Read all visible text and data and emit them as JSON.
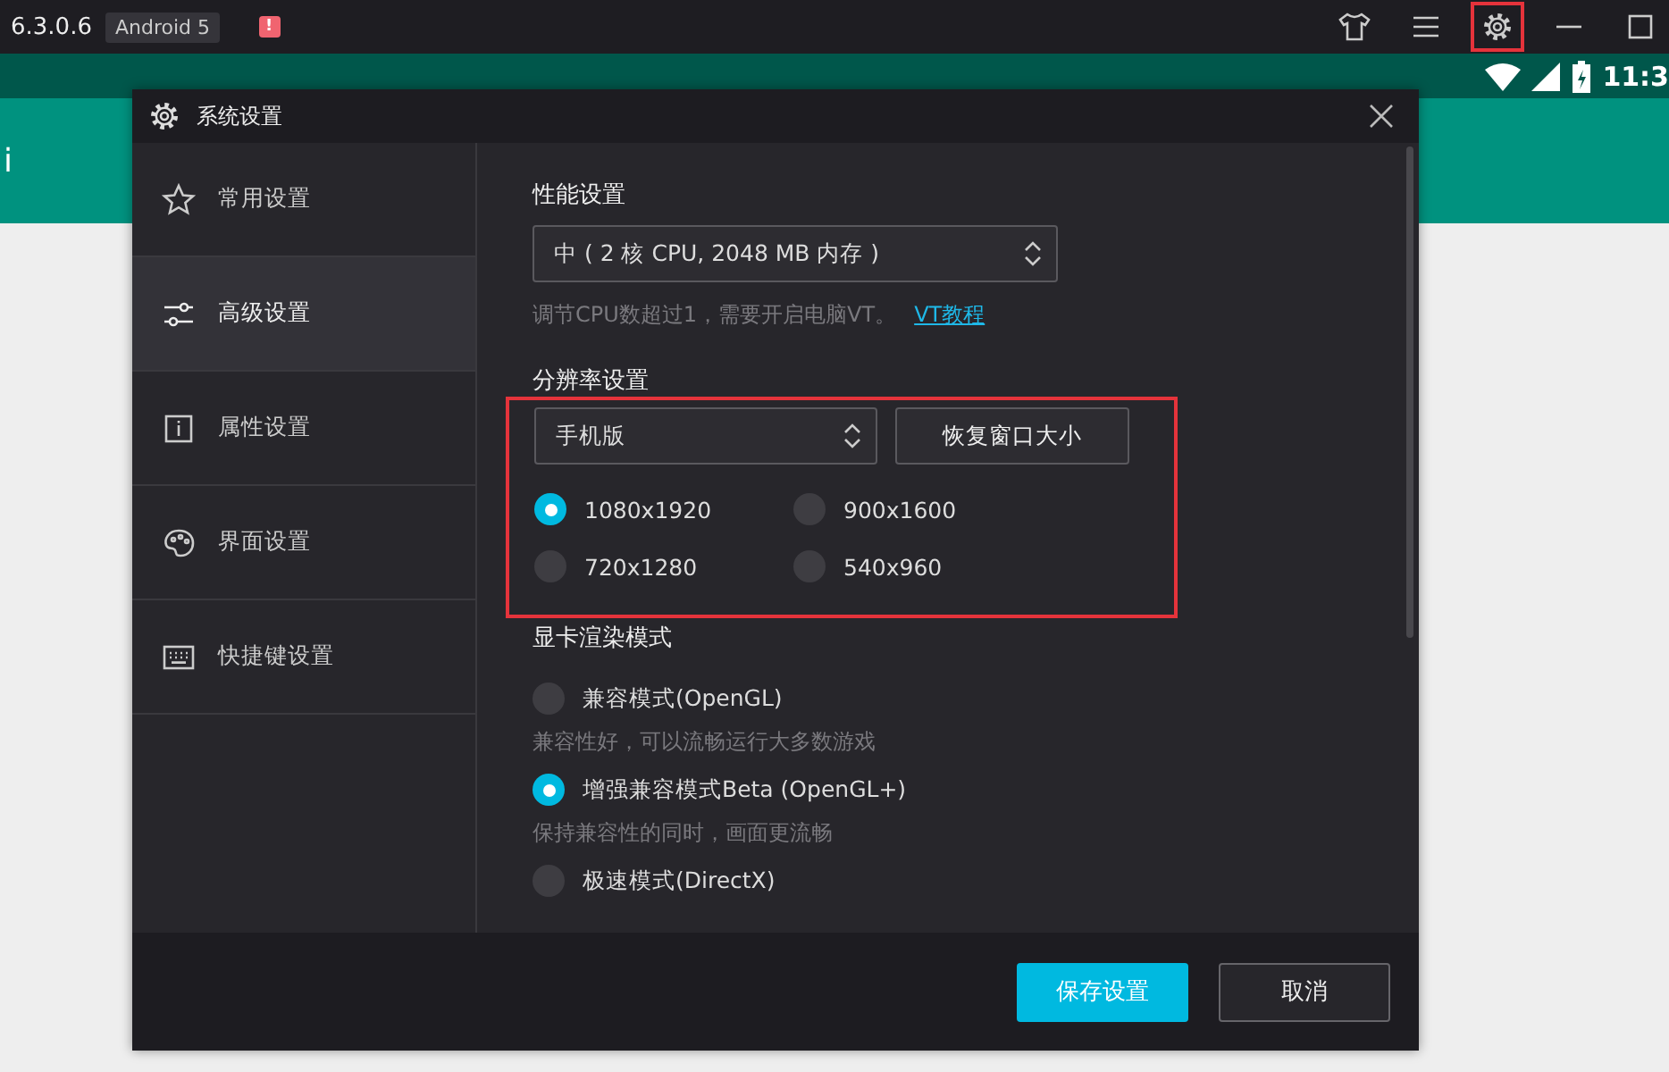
{
  "app_bar": {
    "version": "6.3.0.6",
    "badge": "Android 5",
    "alert": "!",
    "toolbar": [
      {
        "kind": "shirt",
        "highlighted": false
      },
      {
        "kind": "menu",
        "highlighted": false
      },
      {
        "kind": "settings",
        "highlighted": true
      },
      {
        "kind": "minimize",
        "highlighted": false
      },
      {
        "kind": "maximize",
        "highlighted": false
      }
    ]
  },
  "status_bar": {
    "time": "11:3"
  },
  "app_header": {
    "title": "i"
  },
  "dialog": {
    "title": "系统设置",
    "sidebar": [
      {
        "label": "常用设置",
        "kind": "star",
        "selected": false
      },
      {
        "label": "高级设置",
        "kind": "sliders",
        "selected": true
      },
      {
        "label": "属性设置",
        "kind": "info",
        "selected": false
      },
      {
        "label": "界面设置",
        "kind": "palette",
        "selected": false
      },
      {
        "label": "快捷键设置",
        "kind": "keyboard",
        "selected": false
      }
    ],
    "sections": [
      {
        "kind": "select",
        "heading": "性能设置",
        "value": "中 ( 2 核 CPU, 2048 MB 内存 )",
        "hint": "调节CPU数超过1，需要开启电脑VT。",
        "link": "VT教程"
      },
      {
        "kind": "resolution",
        "heading": "分辨率设置",
        "highlighted": true,
        "select": "手机版",
        "button": "恢复窗口大小",
        "options": [
          {
            "label": "1080x1920",
            "selected": true
          },
          {
            "label": "900x1600",
            "selected": false
          },
          {
            "label": "720x1280",
            "selected": false
          },
          {
            "label": "540x960",
            "selected": false
          }
        ]
      },
      {
        "kind": "radio_list",
        "heading": "显卡渲染模式",
        "options": [
          {
            "label": "兼容模式(OpenGL)",
            "selected": false,
            "hint": "兼容性好，可以流畅运行大多数游戏"
          },
          {
            "label": "增强兼容模式Beta (OpenGL+)",
            "selected": true,
            "hint": "保持兼容性的同时，画面更流畅"
          },
          {
            "label": "极速模式(DirectX)",
            "selected": false
          }
        ]
      }
    ],
    "buttons": [
      {
        "label": "保存设置",
        "kind": "primary"
      },
      {
        "label": "取消",
        "kind": "secondary"
      }
    ]
  }
}
